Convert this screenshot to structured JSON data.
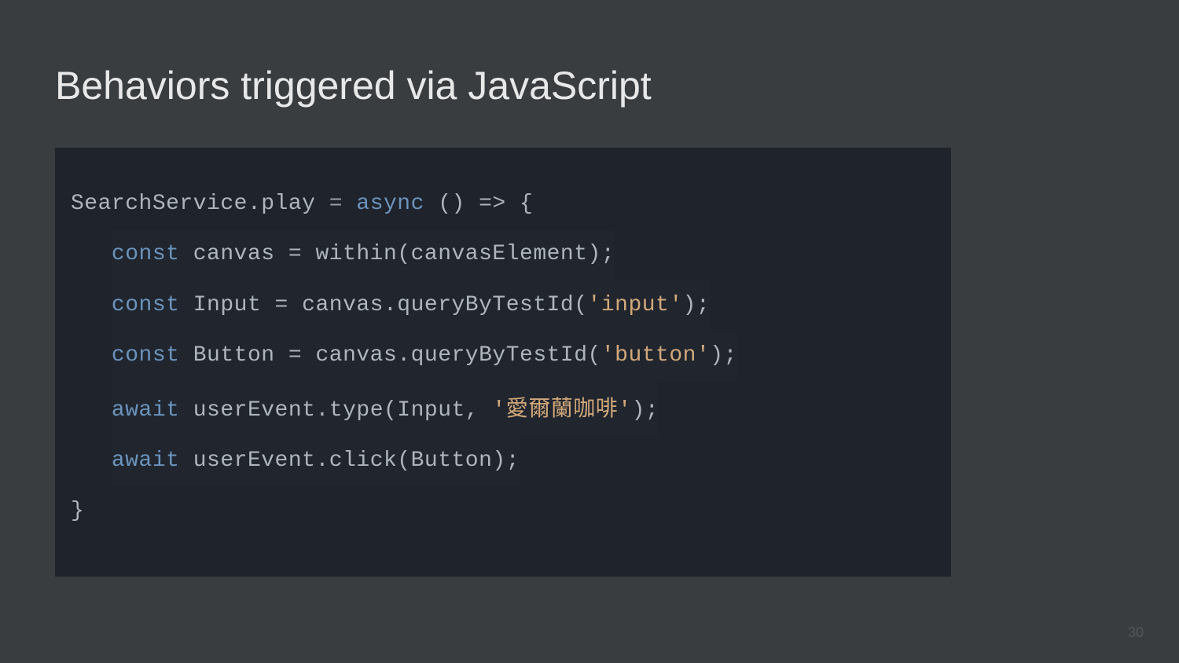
{
  "slide": {
    "title": "Behaviors triggered via JavaScript",
    "pageNumber": "30"
  },
  "code": {
    "line1": {
      "a": "SearchService",
      "b": ".",
      "c": "play",
      "d": " = ",
      "e": "async",
      "f": " () => {"
    },
    "line2": {
      "indent": "   ",
      "a": "const",
      "b": " canvas = ",
      "c": "within",
      "d": "(canvasElement);"
    },
    "line3": {
      "indent": "   ",
      "a": "const",
      "b": " Input = canvas.",
      "c": "queryByTestId",
      "d": "(",
      "e": "'input'",
      "f": ");"
    },
    "line4": {
      "indent": "   ",
      "a": "const",
      "b": " Button = canvas.",
      "c": "queryByTestId",
      "d": "(",
      "e": "'button'",
      "f": ");"
    },
    "line5": {
      "indent": "   ",
      "a": "await",
      "b": " userEvent.",
      "c": "type",
      "d": "(Input, ",
      "e1": "'",
      "e2": "愛爾蘭咖啡",
      "e3": "'",
      "f": ");"
    },
    "line6": {
      "indent": "   ",
      "a": "await",
      "b": " userEvent.",
      "c": "click",
      "d": "(Button);"
    },
    "line7": {
      "a": "}"
    }
  }
}
